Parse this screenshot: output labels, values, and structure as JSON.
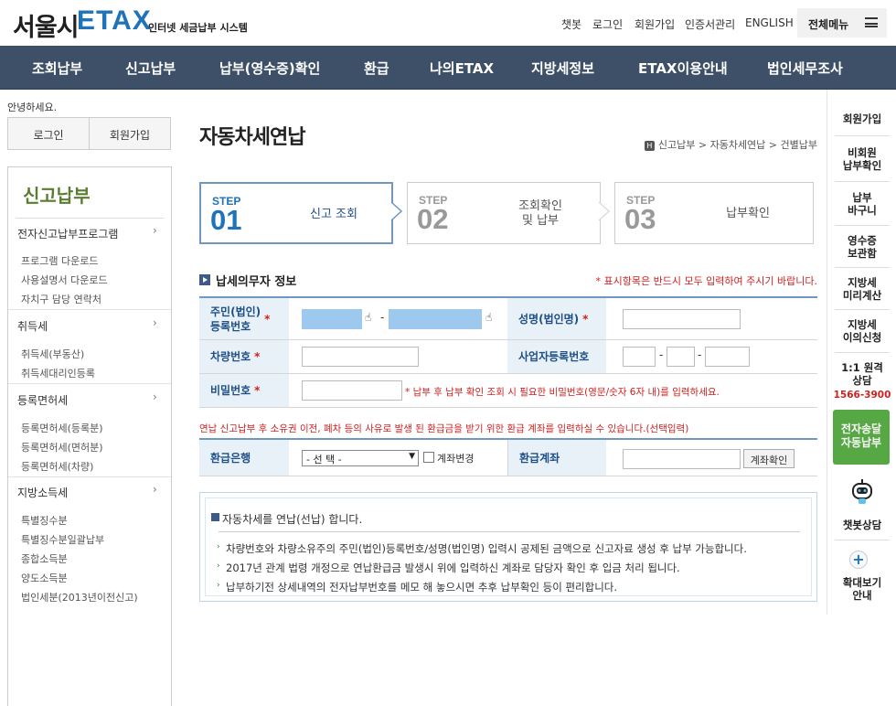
{
  "header": {
    "logo_main": "서울시",
    "logo_brand": "ETAX",
    "logo_sub": "인터넷 세금납부 시스템",
    "util_links": [
      "챗봇",
      "로그인",
      "회원가입",
      "인증서관리",
      "ENGLISH"
    ],
    "all_menu": "전체메뉴"
  },
  "gnb": [
    "조회납부",
    "신고납부",
    "납부(영수증)확인",
    "환급",
    "나의ETAX",
    "지방세정보",
    "ETAX이용안내",
    "법인세무조사"
  ],
  "lnb": {
    "greeting": "안녕하세요.",
    "login": "로그인",
    "signup": "회원가입",
    "title": "신고납부",
    "groups": [
      {
        "label": "전자신고납부프로그램",
        "items": [
          "프로그램 다운로드",
          "사용설명서 다운로드",
          "자치구 담당 연락처"
        ]
      },
      {
        "label": "취득세",
        "items": [
          "취득세(부동산)",
          "취득세대리인등록"
        ]
      },
      {
        "label": "등록면허세",
        "items": [
          "등록면허세(등록분)",
          "등록면허세(면허분)",
          "등록면허세(차량)"
        ]
      },
      {
        "label": "지방소득세",
        "items": [
          "특별징수분",
          "특별징수분일괄납부",
          "종합소득분",
          "양도소득분",
          "법인세분(2013년이전신고)"
        ]
      }
    ]
  },
  "main": {
    "title": "자동차세연납",
    "breadcrumb": "신고납부 > 자동차세연납 > 건별납부",
    "breadcrumb_home": "H",
    "steps": [
      {
        "label": "STEP",
        "num": "01",
        "text": "신고 조회"
      },
      {
        "label": "STEP",
        "num": "02",
        "text": "조회확인\n및 납부"
      },
      {
        "label": "STEP",
        "num": "03",
        "text": "납부확인"
      }
    ],
    "section_title": "납세의무자 정보",
    "required_note": "* 표시항목은 반드시 모두 입력하여 주시기 바랍니다.",
    "fields": {
      "jumin_label": "주민(법인)\n등록번호",
      "name_label": "성명(법인명)",
      "car_label": "차량번호",
      "biz_label": "사업자등록번호",
      "pw_label": "비밀번호",
      "pw_hint": "* 납부 후 납부 확인 조회 시 필요한 비밀번호(영문/숫자 6자 내)를 입력하세요.",
      "star": "*",
      "dash": "-",
      "hand": "☝"
    },
    "refund_note": "연납 신고납부 후 소유권 이전, 폐차 등의 사유로 발생 된 환급금을 받기 위한 환급 계좌를 입력하실 수 있습니다.(선택입력)",
    "refund": {
      "bank_label": "환급은행",
      "bank_select": "- 선 택 -",
      "change_label": "계좌변경",
      "account_label": "환급계좌",
      "check_button": "계좌확인"
    },
    "info": {
      "head": "자동차세를 연납(선납) 합니다.",
      "items": [
        "차량번호와 차량소유주의 주민(법인)등록번호/성명(법인명) 입력시 공제된 금액으로 신고자료 생성 후 납부 가능합니다.",
        "2017년 관계 법령 개정으로 연납환급금 발생시 위에 입력하신 계좌로 담당자 확인 후 입금 처리 됩니다.",
        "납부하기전 상세내역의 전자납부번호를 메모 해 놓으시면 추후 납부확인 등이 편리합니다."
      ]
    }
  },
  "quick": {
    "items": [
      "회원가입",
      "비회원\n납부확인",
      "납부\n바구니",
      "영수증\n보관함",
      "지방세\n미리계산",
      "지방세\n이의신청",
      "1:1 원격\n상담"
    ],
    "phone": "1566-3900",
    "green": "전자송달\n자동납부",
    "chatbot": "챗봇상담",
    "zoom": "확대보기\n안내",
    "zoom_symbol": "+"
  },
  "colors": {
    "gnb_bg": "#3e5067",
    "brand_blue": "#1e73b9",
    "accent_green": "#55a844",
    "required_red": "#d02020",
    "th_bg": "#e9f1f8"
  }
}
